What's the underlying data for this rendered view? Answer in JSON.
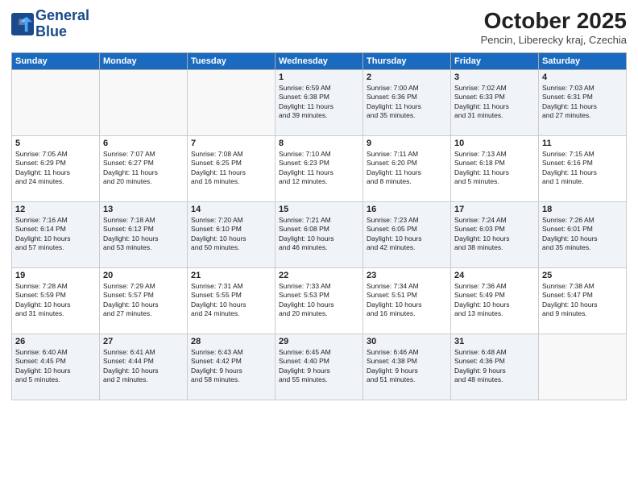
{
  "header": {
    "logo_line1": "General",
    "logo_line2": "Blue",
    "month": "October 2025",
    "location": "Pencin, Liberecky kraj, Czechia"
  },
  "weekdays": [
    "Sunday",
    "Monday",
    "Tuesday",
    "Wednesday",
    "Thursday",
    "Friday",
    "Saturday"
  ],
  "weeks": [
    [
      {
        "day": "",
        "text": ""
      },
      {
        "day": "",
        "text": ""
      },
      {
        "day": "",
        "text": ""
      },
      {
        "day": "1",
        "text": "Sunrise: 6:59 AM\nSunset: 6:38 PM\nDaylight: 11 hours\nand 39 minutes."
      },
      {
        "day": "2",
        "text": "Sunrise: 7:00 AM\nSunset: 6:36 PM\nDaylight: 11 hours\nand 35 minutes."
      },
      {
        "day": "3",
        "text": "Sunrise: 7:02 AM\nSunset: 6:33 PM\nDaylight: 11 hours\nand 31 minutes."
      },
      {
        "day": "4",
        "text": "Sunrise: 7:03 AM\nSunset: 6:31 PM\nDaylight: 11 hours\nand 27 minutes."
      }
    ],
    [
      {
        "day": "5",
        "text": "Sunrise: 7:05 AM\nSunset: 6:29 PM\nDaylight: 11 hours\nand 24 minutes."
      },
      {
        "day": "6",
        "text": "Sunrise: 7:07 AM\nSunset: 6:27 PM\nDaylight: 11 hours\nand 20 minutes."
      },
      {
        "day": "7",
        "text": "Sunrise: 7:08 AM\nSunset: 6:25 PM\nDaylight: 11 hours\nand 16 minutes."
      },
      {
        "day": "8",
        "text": "Sunrise: 7:10 AM\nSunset: 6:23 PM\nDaylight: 11 hours\nand 12 minutes."
      },
      {
        "day": "9",
        "text": "Sunrise: 7:11 AM\nSunset: 6:20 PM\nDaylight: 11 hours\nand 8 minutes."
      },
      {
        "day": "10",
        "text": "Sunrise: 7:13 AM\nSunset: 6:18 PM\nDaylight: 11 hours\nand 5 minutes."
      },
      {
        "day": "11",
        "text": "Sunrise: 7:15 AM\nSunset: 6:16 PM\nDaylight: 11 hours\nand 1 minute."
      }
    ],
    [
      {
        "day": "12",
        "text": "Sunrise: 7:16 AM\nSunset: 6:14 PM\nDaylight: 10 hours\nand 57 minutes."
      },
      {
        "day": "13",
        "text": "Sunrise: 7:18 AM\nSunset: 6:12 PM\nDaylight: 10 hours\nand 53 minutes."
      },
      {
        "day": "14",
        "text": "Sunrise: 7:20 AM\nSunset: 6:10 PM\nDaylight: 10 hours\nand 50 minutes."
      },
      {
        "day": "15",
        "text": "Sunrise: 7:21 AM\nSunset: 6:08 PM\nDaylight: 10 hours\nand 46 minutes."
      },
      {
        "day": "16",
        "text": "Sunrise: 7:23 AM\nSunset: 6:05 PM\nDaylight: 10 hours\nand 42 minutes."
      },
      {
        "day": "17",
        "text": "Sunrise: 7:24 AM\nSunset: 6:03 PM\nDaylight: 10 hours\nand 38 minutes."
      },
      {
        "day": "18",
        "text": "Sunrise: 7:26 AM\nSunset: 6:01 PM\nDaylight: 10 hours\nand 35 minutes."
      }
    ],
    [
      {
        "day": "19",
        "text": "Sunrise: 7:28 AM\nSunset: 5:59 PM\nDaylight: 10 hours\nand 31 minutes."
      },
      {
        "day": "20",
        "text": "Sunrise: 7:29 AM\nSunset: 5:57 PM\nDaylight: 10 hours\nand 27 minutes."
      },
      {
        "day": "21",
        "text": "Sunrise: 7:31 AM\nSunset: 5:55 PM\nDaylight: 10 hours\nand 24 minutes."
      },
      {
        "day": "22",
        "text": "Sunrise: 7:33 AM\nSunset: 5:53 PM\nDaylight: 10 hours\nand 20 minutes."
      },
      {
        "day": "23",
        "text": "Sunrise: 7:34 AM\nSunset: 5:51 PM\nDaylight: 10 hours\nand 16 minutes."
      },
      {
        "day": "24",
        "text": "Sunrise: 7:36 AM\nSunset: 5:49 PM\nDaylight: 10 hours\nand 13 minutes."
      },
      {
        "day": "25",
        "text": "Sunrise: 7:38 AM\nSunset: 5:47 PM\nDaylight: 10 hours\nand 9 minutes."
      }
    ],
    [
      {
        "day": "26",
        "text": "Sunrise: 6:40 AM\nSunset: 4:45 PM\nDaylight: 10 hours\nand 5 minutes."
      },
      {
        "day": "27",
        "text": "Sunrise: 6:41 AM\nSunset: 4:44 PM\nDaylight: 10 hours\nand 2 minutes."
      },
      {
        "day": "28",
        "text": "Sunrise: 6:43 AM\nSunset: 4:42 PM\nDaylight: 9 hours\nand 58 minutes."
      },
      {
        "day": "29",
        "text": "Sunrise: 6:45 AM\nSunset: 4:40 PM\nDaylight: 9 hours\nand 55 minutes."
      },
      {
        "day": "30",
        "text": "Sunrise: 6:46 AM\nSunset: 4:38 PM\nDaylight: 9 hours\nand 51 minutes."
      },
      {
        "day": "31",
        "text": "Sunrise: 6:48 AM\nSunset: 4:36 PM\nDaylight: 9 hours\nand 48 minutes."
      },
      {
        "day": "",
        "text": ""
      }
    ]
  ]
}
